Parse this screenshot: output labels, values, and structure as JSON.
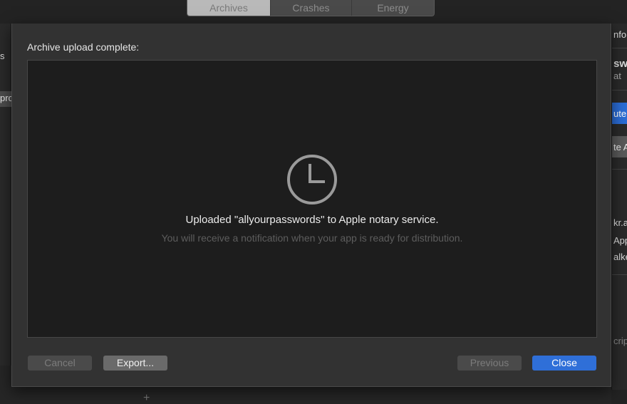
{
  "tabs": [
    {
      "label": "Archives",
      "active": true
    },
    {
      "label": "Crashes",
      "active": false
    },
    {
      "label": "Energy",
      "active": false
    }
  ],
  "background": {
    "left_items": [
      "s",
      "pro"
    ],
    "right_items": [
      "nfor",
      "sw",
      "at",
      "ute",
      "te A",
      "kr.a",
      "App",
      "alke",
      "crip"
    ]
  },
  "dialog": {
    "title": "Archive upload complete:",
    "status_icon": "clock-icon",
    "message": "Uploaded \"allyourpasswords\" to Apple notary service.",
    "submessage": "You will receive a notification when your app is ready for distribution.",
    "buttons": {
      "cancel": "Cancel",
      "export": "Export...",
      "previous": "Previous",
      "close": "Close"
    }
  },
  "colors": {
    "accent": "#2f6fd8",
    "content_bg": "#1d1d1d",
    "dialog_bg": "#323232"
  }
}
